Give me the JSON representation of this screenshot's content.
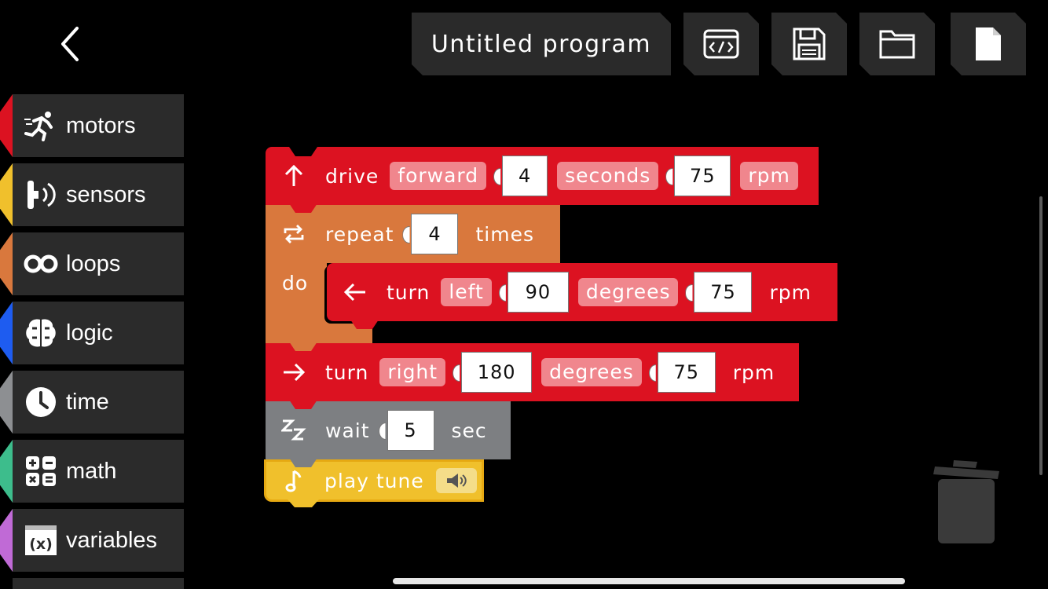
{
  "header": {
    "title": "Untitled program",
    "buttons": [
      {
        "icon": "code-icon"
      },
      {
        "icon": "save-icon"
      },
      {
        "icon": "folder-icon"
      },
      {
        "icon": "new-file-icon"
      }
    ]
  },
  "sidebar": {
    "items": [
      {
        "label": "motors",
        "icon": "running-man-icon",
        "color": "#dc1221"
      },
      {
        "label": "sensors",
        "icon": "sensor-icon",
        "color": "#f0c02c"
      },
      {
        "label": "loops",
        "icon": "infinity-icon",
        "color": "#d9783d"
      },
      {
        "label": "logic",
        "icon": "brain-icon",
        "color": "#1e5cf0"
      },
      {
        "label": "time",
        "icon": "clock-icon",
        "color": "#8d8f92"
      },
      {
        "label": "math",
        "icon": "math-icon",
        "color": "#3dbd8c"
      },
      {
        "label": "variables",
        "icon": "variable-icon",
        "color": "#c06ad6"
      }
    ]
  },
  "program": {
    "drive": {
      "label": "drive",
      "direction": "forward",
      "duration": "4",
      "unit": "seconds",
      "speed": "75",
      "speed_unit": "rpm",
      "color": "#dc1221"
    },
    "repeat": {
      "label": "repeat",
      "count": "4",
      "suffix": "times",
      "do_label": "do",
      "color": "#d9783d"
    },
    "turn_left": {
      "label": "turn",
      "direction": "left",
      "angle": "90",
      "unit": "degrees",
      "speed": "75",
      "speed_unit": "rpm"
    },
    "turn_right": {
      "label": "turn",
      "direction": "right",
      "angle": "180",
      "unit": "degrees",
      "speed": "75",
      "speed_unit": "rpm"
    },
    "wait": {
      "label": "wait",
      "value": "5",
      "unit": "sec",
      "color": "#7d7f82"
    },
    "play_tune": {
      "label": "play tune",
      "color": "#f0c02c"
    }
  }
}
